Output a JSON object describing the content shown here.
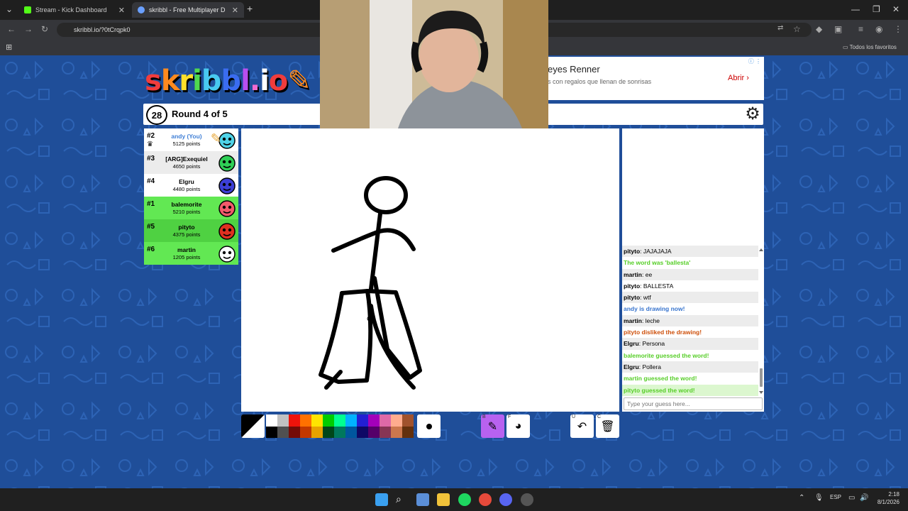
{
  "browser": {
    "tabs": [
      {
        "title": "Stream - Kick Dashboard",
        "active": false
      },
      {
        "title": "skribbl - Free Multiplayer D",
        "active": true
      }
    ],
    "url": "skribbl.io/?0tCrqpk0",
    "bookmarks_label": "Todos los favoritos"
  },
  "game": {
    "logo": "skribbl.io",
    "timer": "28",
    "round": "Round 4 of 5",
    "players": [
      {
        "rank": "#2",
        "name": "andy (You)",
        "points": "5125 points",
        "me": true,
        "guessed": false,
        "color": "#4fd3e8",
        "crown": true
      },
      {
        "rank": "#3",
        "name": "[ARG]Exequiel",
        "points": "4650 points",
        "me": false,
        "guessed": false,
        "color": "#2fcf56",
        "crown": false
      },
      {
        "rank": "#4",
        "name": "Elgru",
        "points": "4480 points",
        "me": false,
        "guessed": false,
        "color": "#3c3fd6",
        "crown": false
      },
      {
        "rank": "#1",
        "name": "balemorite",
        "points": "5210 points",
        "me": false,
        "guessed": true,
        "color": "#f25a6b",
        "crown": false
      },
      {
        "rank": "#5",
        "name": "pityto",
        "points": "4375 points",
        "me": false,
        "guessed": true,
        "color": "#e03020",
        "crown": false
      },
      {
        "rank": "#6",
        "name": "martin",
        "points": "1205 points",
        "me": false,
        "guessed": true,
        "color": "#ffffff",
        "crown": false
      }
    ],
    "chat": [
      {
        "user": "pityto",
        "text": "JAJAJAJA",
        "kind": "normal"
      },
      {
        "user": "",
        "text": "The word was 'ballesta'",
        "kind": "green"
      },
      {
        "user": "martin",
        "text": "ee",
        "kind": "normal"
      },
      {
        "user": "pityto",
        "text": "BALLESTA",
        "kind": "normal"
      },
      {
        "user": "pityto",
        "text": "wtf",
        "kind": "normal"
      },
      {
        "user": "",
        "text": "andy is drawing now!",
        "kind": "blue"
      },
      {
        "user": "martin",
        "text": "leche",
        "kind": "normal"
      },
      {
        "user": "",
        "text": "pityto disliked the drawing!",
        "kind": "orange"
      },
      {
        "user": "Elgru",
        "text": "Persona",
        "kind": "normal"
      },
      {
        "user": "",
        "text": "balemorite guessed the word!",
        "kind": "green"
      },
      {
        "user": "Elgru",
        "text": "Pollera",
        "kind": "normal"
      },
      {
        "user": "",
        "text": "martin guessed the word!",
        "kind": "green"
      },
      {
        "user": "",
        "text": "pityto guessed the word!",
        "kind": "green"
      }
    ],
    "guess_placeholder": "Type your guess here...",
    "palette": [
      "#ffffff",
      "#c1c1c1",
      "#ef130b",
      "#ff7100",
      "#ffe400",
      "#00cc00",
      "#00ff91",
      "#00b2ff",
      "#231fd3",
      "#a300ba",
      "#df69a7",
      "#ffac8e",
      "#a0522d",
      "#000000",
      "#505050",
      "#740b07",
      "#c23800",
      "#e8a200",
      "#004619",
      "#00785d",
      "#00569e",
      "#0e0865",
      "#550069",
      "#873554",
      "#cc774d",
      "#63300d"
    ],
    "tool_keys": {
      "brush": "B",
      "fill": "F",
      "undo": "U",
      "clear": "C"
    }
  },
  "ad": {
    "title": "eyes Renner",
    "subtitle": "s con regalos que llenan de sonrisas",
    "button": "Abrir"
  },
  "taskbar": {
    "lang": "ESP",
    "time": "2:18",
    "date": "8/1/2026"
  }
}
